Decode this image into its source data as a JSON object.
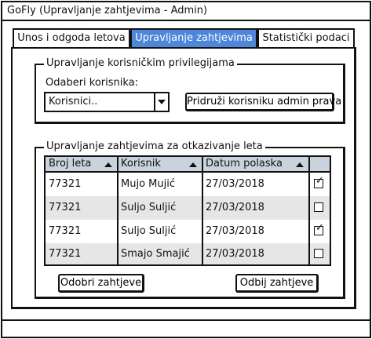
{
  "window": {
    "title": "GoFly (Upravljanje zahtjevima - Admin)"
  },
  "tabs": [
    {
      "label": "Unos i odgoda letova",
      "active": false
    },
    {
      "label": "Upravljanje zahtjevima",
      "active": true
    },
    {
      "label": "Statistički podaci",
      "active": false
    }
  ],
  "privileges": {
    "legend": "Upravljanje korisničkim privilegijama",
    "select_label": "Odaberi korisnika:",
    "select_value": "Korisnici..",
    "assign_button": "Pridruži korisniku admin prava"
  },
  "requests": {
    "legend": "Upravljanje zahtjevima za otkazivanje leta",
    "columns": [
      "Broj leta",
      "Korisnik",
      "Datum polaska",
      ""
    ],
    "rows": [
      {
        "flight": "77321",
        "user": "Mujo Mujić",
        "date": "27/03/2018",
        "checked": true
      },
      {
        "flight": "77321",
        "user": "Suljo Suljić",
        "date": "27/03/2018",
        "checked": false
      },
      {
        "flight": "77321",
        "user": "Suljo Suljić",
        "date": "27/03/2018",
        "checked": true
      },
      {
        "flight": "77321",
        "user": "Smajo Smajić",
        "date": "27/03/2018",
        "checked": false
      }
    ],
    "approve_button": "Odobri zahtjeve",
    "reject_button": "Odbij zahtjeve"
  },
  "icons": {
    "sort": "sort-asc-icon",
    "dropdown": "chevron-down-icon",
    "check": "check-icon"
  }
}
